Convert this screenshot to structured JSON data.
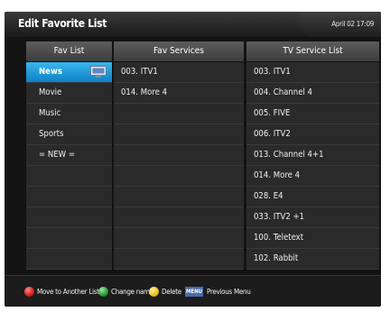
{
  "header": {
    "title": "Edit Favorite List",
    "datetime": "April 02 17:09"
  },
  "fav_list": {
    "header": "Fav List",
    "selected_index": 0,
    "items": [
      "News",
      "Movie",
      "Music",
      "Sports",
      "= NEW =",
      "",
      "",
      "",
      "",
      ""
    ]
  },
  "fav_services": {
    "header": "Fav Services",
    "items": [
      "003. ITV1",
      "014. More 4",
      "",
      "",
      "",
      "",
      "",
      "",
      "",
      ""
    ]
  },
  "tv_service_list": {
    "header": "TV Service List",
    "items": [
      "003. ITV1",
      "004. Channel 4",
      "005. FIVE",
      "006. ITV2",
      "013. Channel 4+1",
      "014. More 4",
      "028. E4",
      "033. ITV2 +1",
      "100. Teletext",
      "102. Rabbit"
    ]
  },
  "footer": {
    "red_label": "Move to Another List",
    "green_label": "Change name",
    "yellow_label": "Delete",
    "menu_key": "MENU",
    "menu_label": "Previous Menu",
    "colors": {
      "red": "#d42020",
      "green": "#1f9a3a",
      "yellow": "#e8c21a",
      "blue": "#4a6aa8"
    }
  },
  "icons": {
    "selected_item": "tv-icon"
  },
  "colors": {
    "selection": "#1f9ad8",
    "background": "#131313"
  }
}
